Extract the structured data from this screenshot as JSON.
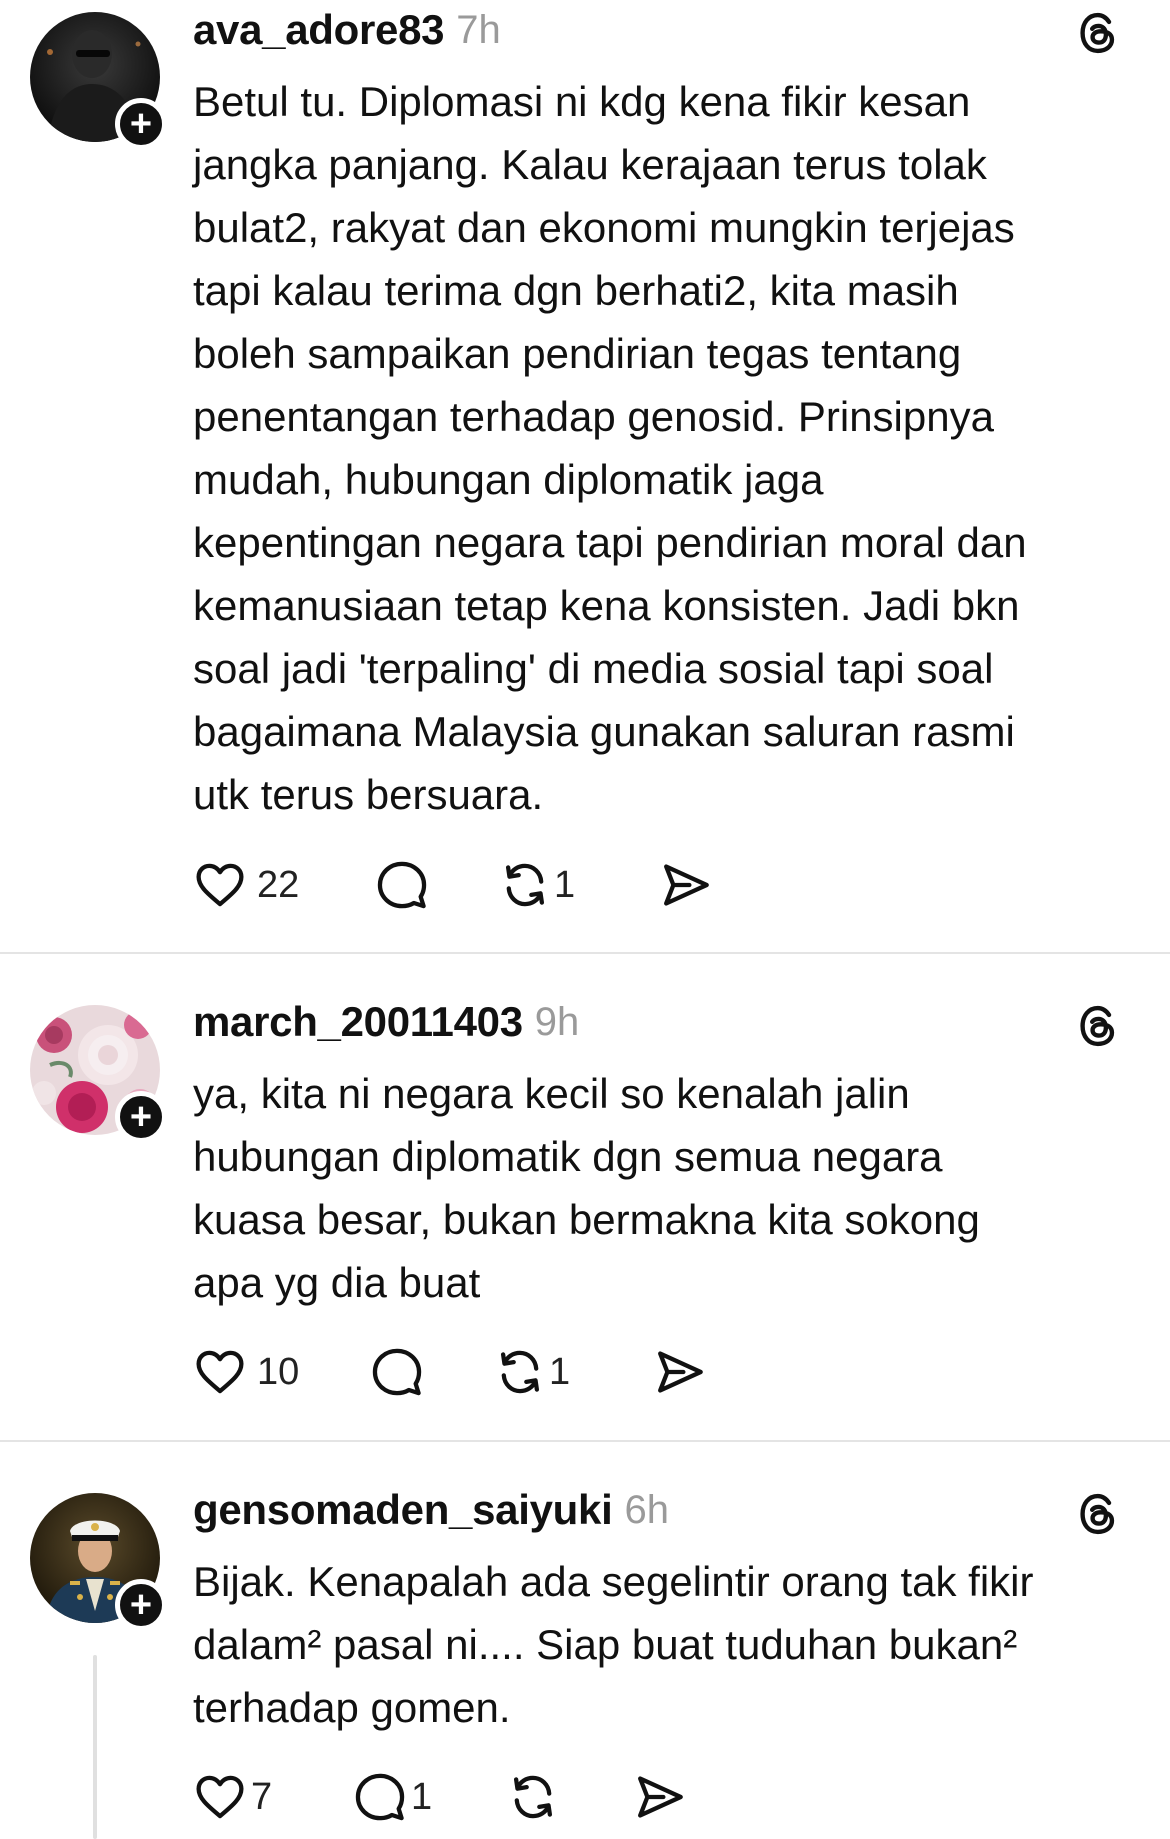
{
  "posts": [
    {
      "username": "ava_adore83",
      "time": "7h",
      "text": "Betul tu. Diplomasi ni kdg kena fikir kesan\njangka panjang. Kalau kerajaan terus tolak\nbulat2, rakyat dan ekonomi mungkin terjejas\ntapi kalau terima dgn berhati2, kita masih\nboleh sampaikan pendirian tegas tentang\npenentangan terhadap genosid. Prinsipnya\nmudah, hubungan diplomatik jaga\nkepentingan negara tapi pendirian moral dan\nkemanusiaan tetap kena konsisten. Jadi bkn\nsoal jadi 'terpaling' di media sosial tapi soal\nbagaimana Malaysia gunakan saluran rasmi\nutk terus bersuara.",
      "likes": "22",
      "replies": "",
      "reposts": "1",
      "follow": "+"
    },
    {
      "username": "march_20011403",
      "time": "9h",
      "text": "ya, kita ni negara kecil so kenalah jalin\nhubungan diplomatik dgn semua negara\nkuasa besar, bukan bermakna kita sokong\napa yg dia buat",
      "likes": "10",
      "replies": "",
      "reposts": "1",
      "follow": "+"
    },
    {
      "username": "gensomaden_saiyuki",
      "time": "6h",
      "text": "Bijak. Kenapalah ada segelintir orang tak fikir\ndalam² pasal ni.... Siap buat tuduhan bukan²\nterhadap gomen.",
      "likes": "7",
      "replies": "1",
      "reposts": "",
      "follow": "+"
    }
  ],
  "icons": {
    "like": "heart-icon",
    "reply": "comment-icon",
    "repost": "repost-icon",
    "share": "send-icon",
    "app": "threads-logo-icon"
  },
  "colors": {
    "text": "#111111",
    "muted": "#9a9a9a",
    "divider": "#e4e4e4"
  }
}
